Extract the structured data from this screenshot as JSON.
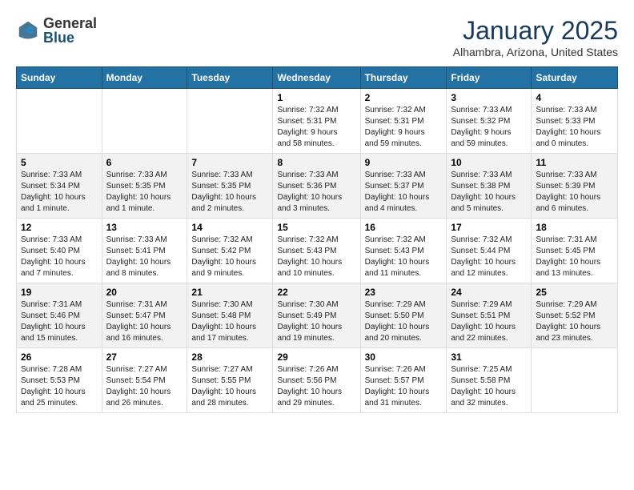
{
  "logo": {
    "general": "General",
    "blue": "Blue"
  },
  "title": "January 2025",
  "location": "Alhambra, Arizona, United States",
  "days_header": [
    "Sunday",
    "Monday",
    "Tuesday",
    "Wednesday",
    "Thursday",
    "Friday",
    "Saturday"
  ],
  "weeks": [
    [
      {
        "day": "",
        "info": ""
      },
      {
        "day": "",
        "info": ""
      },
      {
        "day": "",
        "info": ""
      },
      {
        "day": "1",
        "info": "Sunrise: 7:32 AM\nSunset: 5:31 PM\nDaylight: 9 hours\nand 58 minutes."
      },
      {
        "day": "2",
        "info": "Sunrise: 7:32 AM\nSunset: 5:31 PM\nDaylight: 9 hours\nand 59 minutes."
      },
      {
        "day": "3",
        "info": "Sunrise: 7:33 AM\nSunset: 5:32 PM\nDaylight: 9 hours\nand 59 minutes."
      },
      {
        "day": "4",
        "info": "Sunrise: 7:33 AM\nSunset: 5:33 PM\nDaylight: 10 hours\nand 0 minutes."
      }
    ],
    [
      {
        "day": "5",
        "info": "Sunrise: 7:33 AM\nSunset: 5:34 PM\nDaylight: 10 hours\nand 1 minute."
      },
      {
        "day": "6",
        "info": "Sunrise: 7:33 AM\nSunset: 5:35 PM\nDaylight: 10 hours\nand 1 minute."
      },
      {
        "day": "7",
        "info": "Sunrise: 7:33 AM\nSunset: 5:35 PM\nDaylight: 10 hours\nand 2 minutes."
      },
      {
        "day": "8",
        "info": "Sunrise: 7:33 AM\nSunset: 5:36 PM\nDaylight: 10 hours\nand 3 minutes."
      },
      {
        "day": "9",
        "info": "Sunrise: 7:33 AM\nSunset: 5:37 PM\nDaylight: 10 hours\nand 4 minutes."
      },
      {
        "day": "10",
        "info": "Sunrise: 7:33 AM\nSunset: 5:38 PM\nDaylight: 10 hours\nand 5 minutes."
      },
      {
        "day": "11",
        "info": "Sunrise: 7:33 AM\nSunset: 5:39 PM\nDaylight: 10 hours\nand 6 minutes."
      }
    ],
    [
      {
        "day": "12",
        "info": "Sunrise: 7:33 AM\nSunset: 5:40 PM\nDaylight: 10 hours\nand 7 minutes."
      },
      {
        "day": "13",
        "info": "Sunrise: 7:33 AM\nSunset: 5:41 PM\nDaylight: 10 hours\nand 8 minutes."
      },
      {
        "day": "14",
        "info": "Sunrise: 7:32 AM\nSunset: 5:42 PM\nDaylight: 10 hours\nand 9 minutes."
      },
      {
        "day": "15",
        "info": "Sunrise: 7:32 AM\nSunset: 5:43 PM\nDaylight: 10 hours\nand 10 minutes."
      },
      {
        "day": "16",
        "info": "Sunrise: 7:32 AM\nSunset: 5:43 PM\nDaylight: 10 hours\nand 11 minutes."
      },
      {
        "day": "17",
        "info": "Sunrise: 7:32 AM\nSunset: 5:44 PM\nDaylight: 10 hours\nand 12 minutes."
      },
      {
        "day": "18",
        "info": "Sunrise: 7:31 AM\nSunset: 5:45 PM\nDaylight: 10 hours\nand 13 minutes."
      }
    ],
    [
      {
        "day": "19",
        "info": "Sunrise: 7:31 AM\nSunset: 5:46 PM\nDaylight: 10 hours\nand 15 minutes."
      },
      {
        "day": "20",
        "info": "Sunrise: 7:31 AM\nSunset: 5:47 PM\nDaylight: 10 hours\nand 16 minutes."
      },
      {
        "day": "21",
        "info": "Sunrise: 7:30 AM\nSunset: 5:48 PM\nDaylight: 10 hours\nand 17 minutes."
      },
      {
        "day": "22",
        "info": "Sunrise: 7:30 AM\nSunset: 5:49 PM\nDaylight: 10 hours\nand 19 minutes."
      },
      {
        "day": "23",
        "info": "Sunrise: 7:29 AM\nSunset: 5:50 PM\nDaylight: 10 hours\nand 20 minutes."
      },
      {
        "day": "24",
        "info": "Sunrise: 7:29 AM\nSunset: 5:51 PM\nDaylight: 10 hours\nand 22 minutes."
      },
      {
        "day": "25",
        "info": "Sunrise: 7:29 AM\nSunset: 5:52 PM\nDaylight: 10 hours\nand 23 minutes."
      }
    ],
    [
      {
        "day": "26",
        "info": "Sunrise: 7:28 AM\nSunset: 5:53 PM\nDaylight: 10 hours\nand 25 minutes."
      },
      {
        "day": "27",
        "info": "Sunrise: 7:27 AM\nSunset: 5:54 PM\nDaylight: 10 hours\nand 26 minutes."
      },
      {
        "day": "28",
        "info": "Sunrise: 7:27 AM\nSunset: 5:55 PM\nDaylight: 10 hours\nand 28 minutes."
      },
      {
        "day": "29",
        "info": "Sunrise: 7:26 AM\nSunset: 5:56 PM\nDaylight: 10 hours\nand 29 minutes."
      },
      {
        "day": "30",
        "info": "Sunrise: 7:26 AM\nSunset: 5:57 PM\nDaylight: 10 hours\nand 31 minutes."
      },
      {
        "day": "31",
        "info": "Sunrise: 7:25 AM\nSunset: 5:58 PM\nDaylight: 10 hours\nand 32 minutes."
      },
      {
        "day": "",
        "info": ""
      }
    ]
  ]
}
